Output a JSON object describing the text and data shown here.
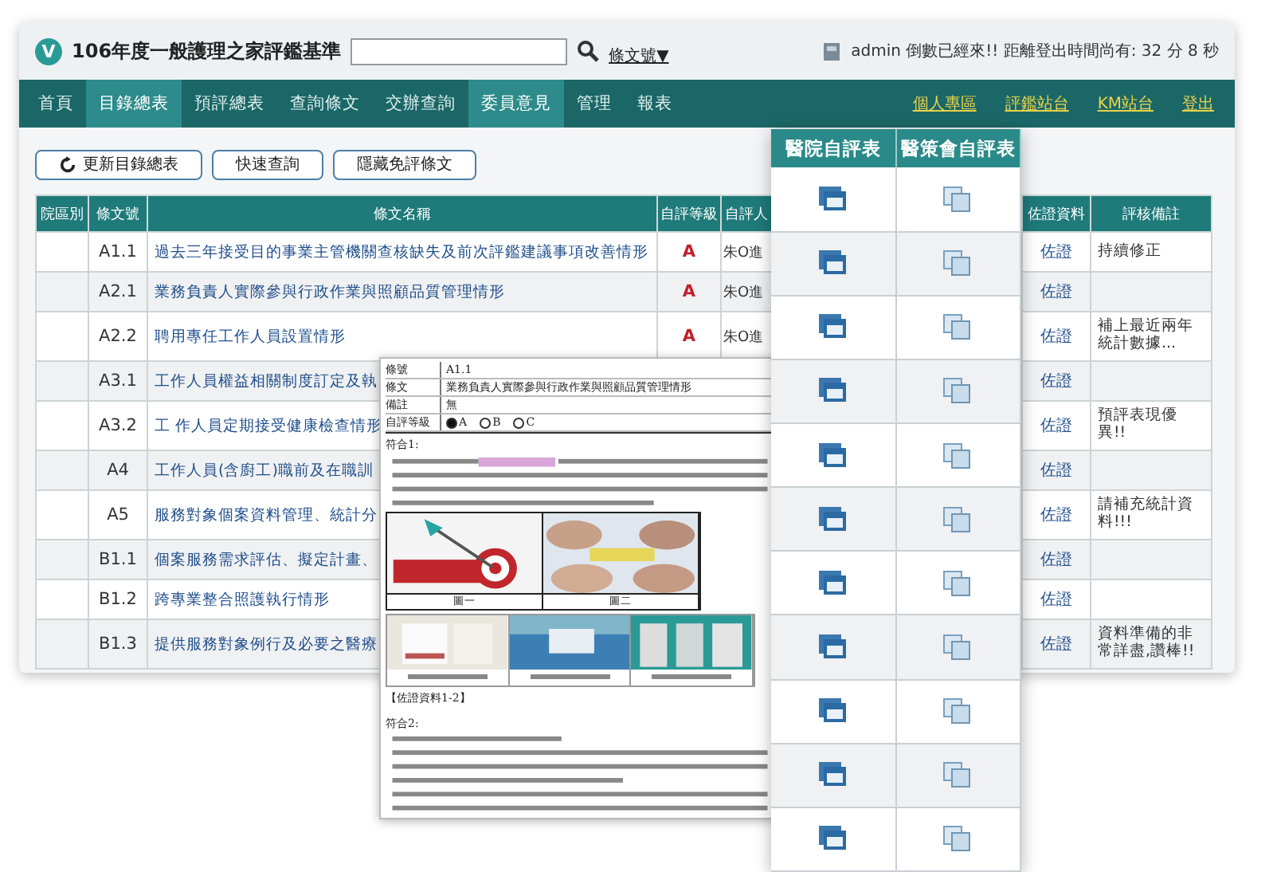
{
  "header": {
    "logo": "V",
    "title": "106年度一般護理之家評鑑基準",
    "article_link": "條文號▼",
    "status": "admin 倒數已經來!! 距離登出時間尚有: 32 分 8 秒"
  },
  "nav": {
    "items": [
      {
        "label": "首頁",
        "selected": false
      },
      {
        "label": "目錄總表",
        "selected": true
      },
      {
        "label": "預評總表",
        "selected": false
      },
      {
        "label": "查詢條文",
        "selected": false
      },
      {
        "label": "交辦查詢",
        "selected": false
      },
      {
        "label": "委員意見",
        "selected": true
      },
      {
        "label": "管理",
        "selected": false
      },
      {
        "label": "報表",
        "selected": false
      }
    ],
    "right_links": [
      "個人專區",
      "評鑑站台",
      "KM站台",
      "登出"
    ]
  },
  "toolbar": {
    "buttons": [
      {
        "label": "更新目錄總表",
        "kind": "refresh"
      },
      {
        "label": "快速查詢",
        "kind": "plain"
      },
      {
        "label": "隱藏免評條文",
        "kind": "plain"
      }
    ]
  },
  "table": {
    "columns": [
      "院區別",
      "條文號",
      "條文名稱",
      "自評等級",
      "自評人",
      "佐證資料",
      "評核備註"
    ],
    "rows": [
      {
        "article": "A1.1",
        "name": "過去三年接受目的事業主管機關查核缺失及前次評鑑建議事項改善情形",
        "grade": "A",
        "assessor": "朱O進",
        "evidence": "佐證",
        "remark": "持續修正"
      },
      {
        "article": "A2.1",
        "name": "業務負責人實際參與行政作業與照顧品質管理情形",
        "grade": "A",
        "assessor": "朱O進",
        "evidence": "佐證"
      },
      {
        "article": "A2.2",
        "name": "聘用專任工作人員設置情形",
        "grade": "A",
        "assessor": "朱O進",
        "evidence": "佐證",
        "remark": "補上最近兩年統計數據..."
      },
      {
        "article": "A3.1",
        "name": "工作人員權益相關制度訂定及執",
        "evidence": "佐證"
      },
      {
        "article": "A3.2",
        "name": "工 作人員定期接受健康檢查情形",
        "evidence": "佐證",
        "remark": "預評表現優異!!"
      },
      {
        "article": "A4",
        "name": "工作人員(含廚工)職前及在職訓",
        "evidence": "佐證"
      },
      {
        "article": "A5",
        "name": "服務對象個案資料管理、統計分",
        "evidence": "佐證",
        "remark": "請補充統計資料!!!"
      },
      {
        "article": "B1.1",
        "name": "個案服務需求評估、擬定計畫、",
        "evidence": "佐證"
      },
      {
        "article": "B1.2",
        "name": "跨專業整合照護執行情形",
        "evidence": "佐證"
      },
      {
        "article": "B1.3",
        "name": "提供服務對象例行及必要之醫療",
        "evidence": "佐證",
        "remark": "資料準備的非常詳盡,讚棒!!"
      }
    ]
  },
  "popup": {
    "columns": [
      "醫院自評表",
      "醫策會自評表"
    ],
    "rows": [
      {
        "kind": "icons"
      },
      {
        "kind": "icons"
      },
      {
        "kind": "icons"
      },
      {
        "kind": "icons"
      },
      {
        "kind": "icons"
      },
      {
        "kind": "icons"
      },
      {
        "kind": "icons"
      },
      {
        "kind": "icons"
      },
      {
        "kind": "icons"
      },
      {
        "kind": "icons"
      },
      {
        "kind": "icons"
      }
    ]
  },
  "document": {
    "fields": [
      {
        "label": "條號",
        "value": "A1.1"
      },
      {
        "label": "條文",
        "value": "業務負責人實際參與行政作業與照顧品質管理情形"
      },
      {
        "label": "備註",
        "value": "無"
      }
    ],
    "grade_label": "自評等級",
    "grade_options": [
      {
        "label": "A",
        "selected": true
      },
      {
        "label": "B",
        "selected": false
      },
      {
        "label": "C",
        "selected": false
      }
    ],
    "section_1": "符合1:",
    "figure_captions": [
      "圖一",
      "圖二"
    ],
    "evidence_label": "【佐證資料1-2】",
    "section_2": "符合2:"
  }
}
